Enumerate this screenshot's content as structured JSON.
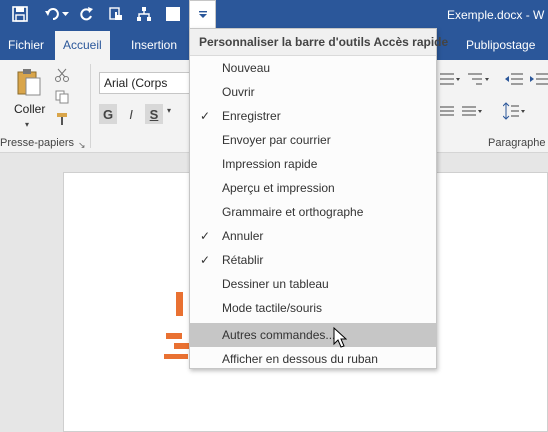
{
  "window": {
    "doc_title": "Exemple.docx - W"
  },
  "qat": {
    "buttons": [
      "save-icon",
      "undo-icon",
      "redo-icon",
      "touch-mode-icon",
      "draw-table-icon",
      "blank-icon"
    ],
    "customize_icon": "chevron-down-icon"
  },
  "tabs": [
    {
      "label": "Fichier"
    },
    {
      "label": "Accueil"
    },
    {
      "label": "Insertion"
    },
    {
      "label": "Publipostage"
    }
  ],
  "ribbon": {
    "paste_label": "Coller",
    "clipboard_label": "Presse-papiers",
    "paragraph_label": "Paragraphe",
    "font_name": "Arial (Corps",
    "bold": "G",
    "italic": "I",
    "underline": "S"
  },
  "menu": {
    "title": "Personnaliser la barre d'outils Accès rapide",
    "items": [
      {
        "label": "Nouveau",
        "checked": ""
      },
      {
        "label": "Ouvrir",
        "checked": ""
      },
      {
        "label": "Enregistrer",
        "checked": "✓"
      },
      {
        "label": "Envoyer par courrier",
        "checked": ""
      },
      {
        "label": "Impression rapide",
        "checked": ""
      },
      {
        "label": "Aperçu et impression",
        "checked": ""
      },
      {
        "label": "Grammaire et orthographe",
        "checked": ""
      },
      {
        "label": "Annuler",
        "checked": "✓"
      },
      {
        "label": "Rétablir",
        "checked": "✓"
      },
      {
        "label": "Dessiner un tableau",
        "checked": ""
      },
      {
        "label": "Mode tactile/souris",
        "checked": ""
      },
      {
        "label": "Autres commandes...",
        "checked": ""
      },
      {
        "label": "Afficher en dessous du ruban",
        "checked": ""
      }
    ]
  },
  "colors": {
    "brand": "#2b579a",
    "accent_orange": "#e97132"
  }
}
